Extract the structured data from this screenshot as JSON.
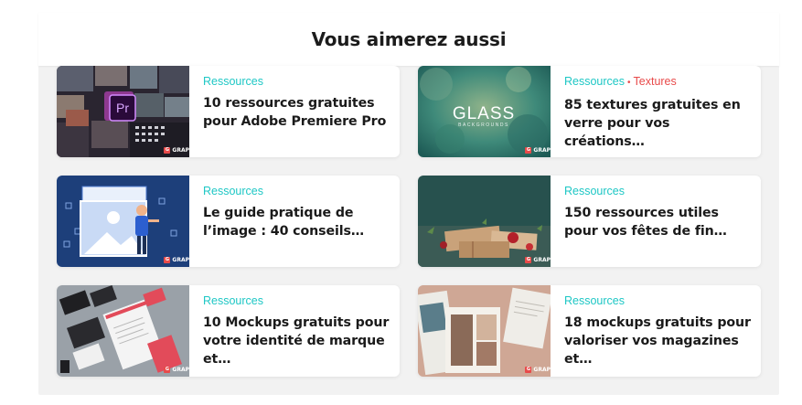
{
  "section": {
    "title": "Vous aimerez aussi"
  },
  "brand": {
    "badge_text": "GRAP",
    "badge_letter": "G",
    "accent_color": "#1ec7c5",
    "tag_color": "#e84a4a"
  },
  "cards": [
    {
      "categories": [
        "Ressources"
      ],
      "title": "10 ressources gratuites pour Adobe Premiere Pro",
      "thumb_icon": "premiere-pro-icon",
      "thumb_text": "Pr"
    },
    {
      "categories": [
        "Ressources",
        "Textures"
      ],
      "title": "85 textures gratuites en verre pour vos créations…",
      "thumb_icon": "glass-texture",
      "thumb_text": "GLASS",
      "thumb_subtext": "BACKGROUNDS"
    },
    {
      "categories": [
        "Ressources"
      ],
      "title": "Le guide pratique de l’image : 40 conseils…",
      "thumb_icon": "image-illustration"
    },
    {
      "categories": [
        "Ressources"
      ],
      "title": "150 ressources utiles pour vos fêtes de fin…",
      "thumb_icon": "gift-photo"
    },
    {
      "categories": [
        "Ressources"
      ],
      "title": "10 Mockups gratuits pour votre identité de marque et…",
      "thumb_icon": "stationery-mockup"
    },
    {
      "categories": [
        "Ressources"
      ],
      "title": "18 mockups gratuits pour valoriser vos magazines et…",
      "thumb_icon": "magazine-mockup"
    }
  ]
}
